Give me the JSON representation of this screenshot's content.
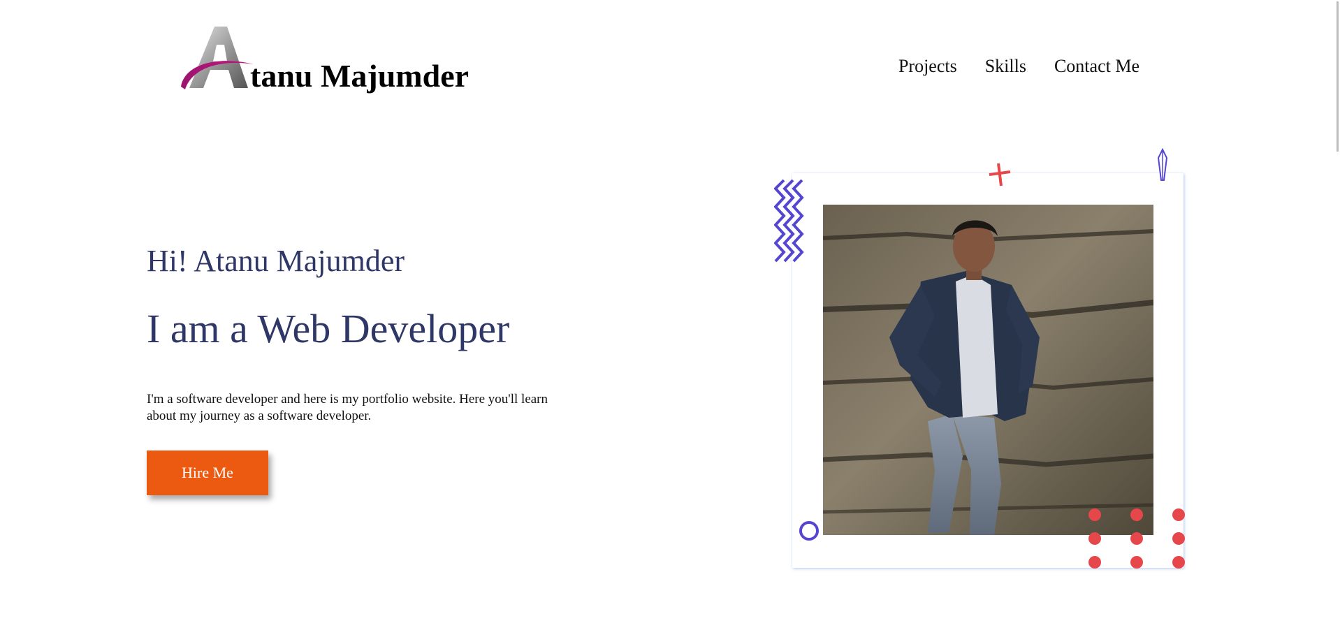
{
  "logo": {
    "initial": "A",
    "text": "tanu Majumder"
  },
  "nav": {
    "items": [
      {
        "label": "Projects"
      },
      {
        "label": "Skills"
      },
      {
        "label": "Contact Me"
      }
    ]
  },
  "hero": {
    "greeting": "Hi! Atanu Majumder",
    "title": "I am a Web Developer",
    "description": "I'm a software developer and here is my portfolio website. Here you'll learn about my journey as a software developer.",
    "cta_label": "Hire Me"
  },
  "colors": {
    "heading": "#2e3766",
    "accent": "#ec5a12",
    "deco_blue": "#5546d1",
    "deco_red": "#e5474b"
  }
}
